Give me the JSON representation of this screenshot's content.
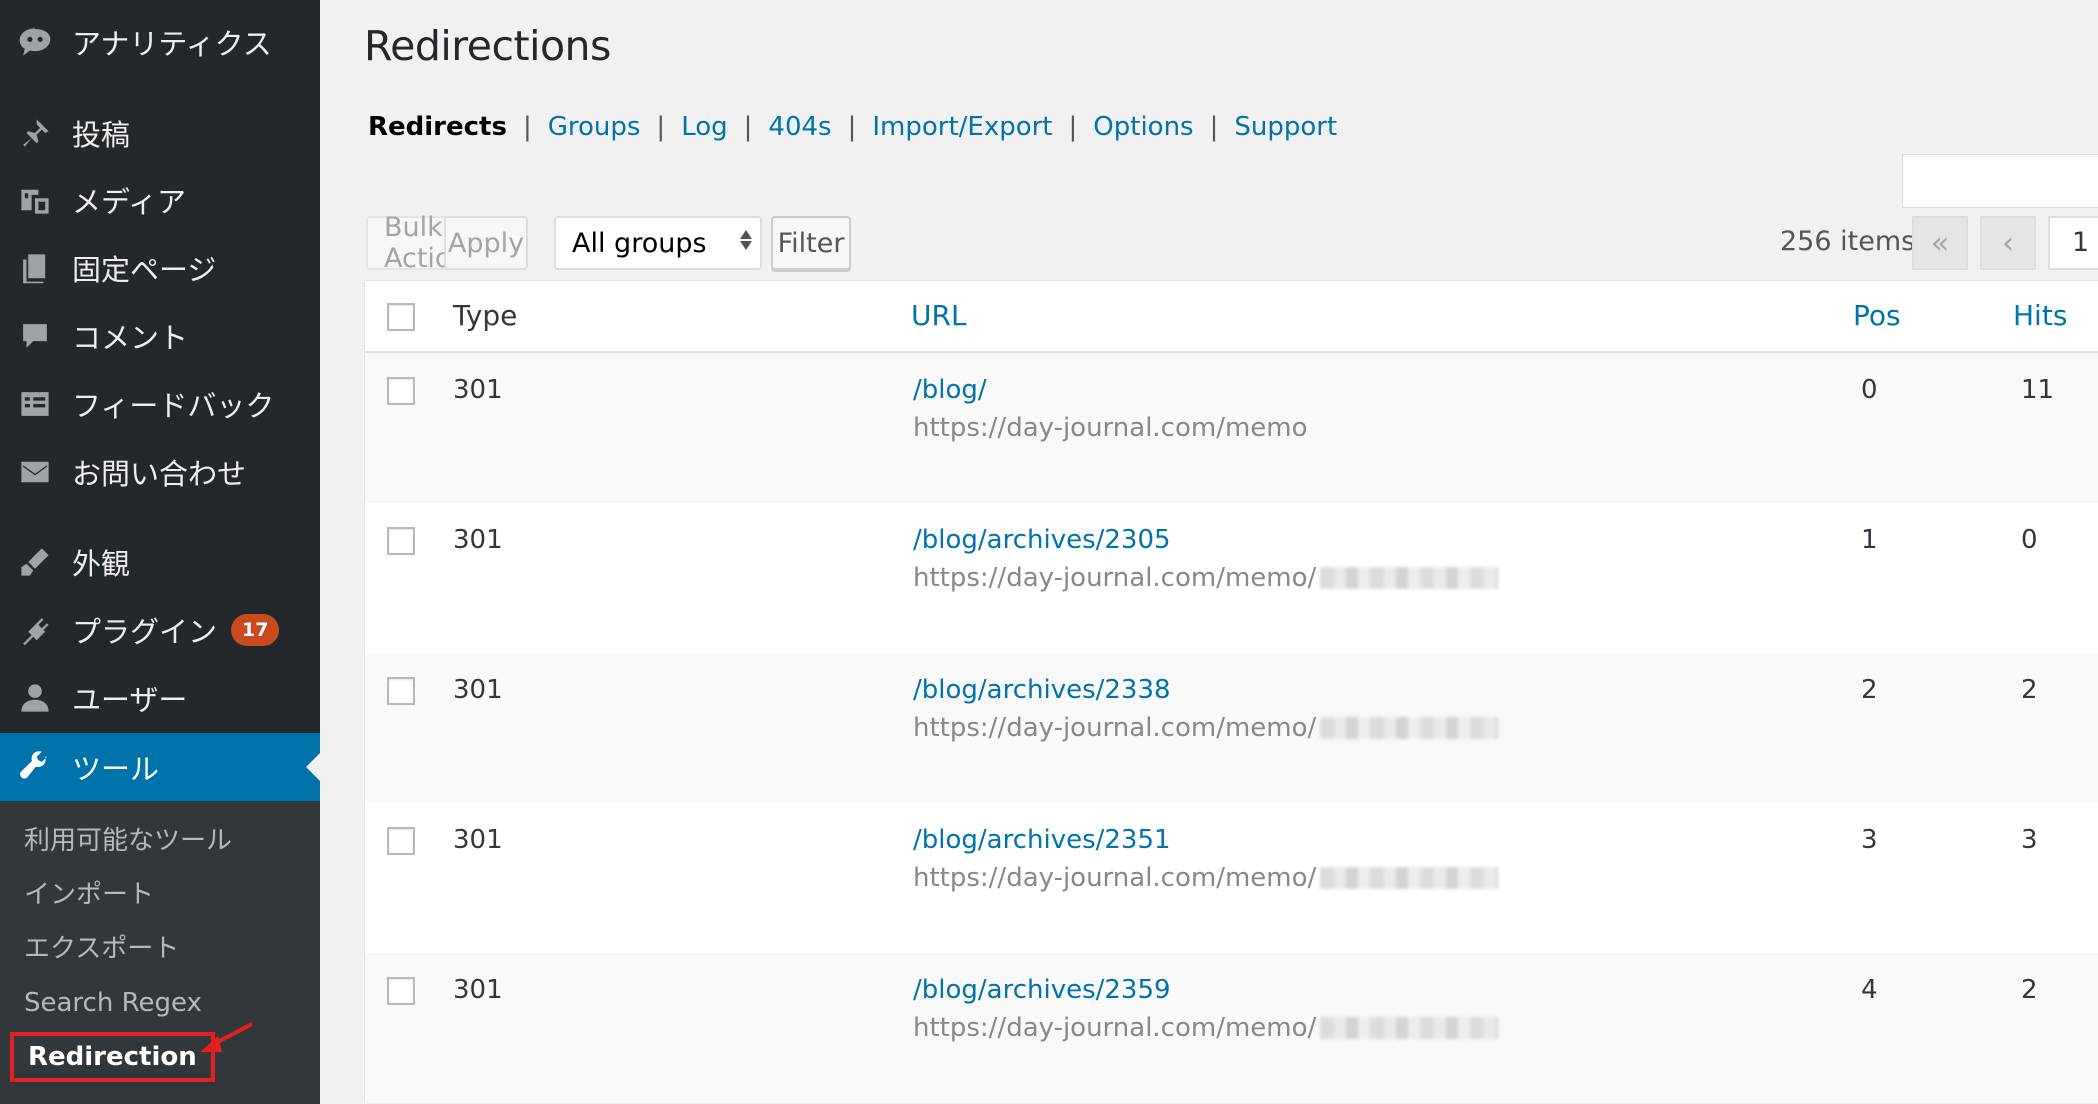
{
  "sidebar": {
    "top_item": {
      "label": "アナリティクス",
      "icon": "analytics-icon"
    },
    "items": [
      {
        "label": "投稿",
        "icon": "pin-icon"
      },
      {
        "label": "メディア",
        "icon": "media-icon"
      },
      {
        "label": "固定ページ",
        "icon": "pages-icon"
      },
      {
        "label": "コメント",
        "icon": "comment-icon"
      },
      {
        "label": "フィードバック",
        "icon": "feedback-icon"
      },
      {
        "label": "お問い合わせ",
        "icon": "mail-icon"
      },
      {
        "label": "外観",
        "icon": "brush-icon"
      },
      {
        "label": "プラグイン",
        "icon": "plugin-icon",
        "badge": "17"
      },
      {
        "label": "ユーザー",
        "icon": "user-icon"
      },
      {
        "label": "ツール",
        "icon": "wrench-icon",
        "active": true
      }
    ],
    "submenu": [
      {
        "label": "利用可能なツール"
      },
      {
        "label": "インポート"
      },
      {
        "label": "エクスポート"
      },
      {
        "label": "Search Regex"
      },
      {
        "label": "Redirection",
        "current": true
      }
    ],
    "accent_color": "#0073aa",
    "badge_color": "#ca4a1f",
    "highlight_color": "#e52020"
  },
  "page": {
    "title": "Redirections",
    "subnav": [
      {
        "label": "Redirects",
        "current": true
      },
      {
        "label": "Groups"
      },
      {
        "label": "Log"
      },
      {
        "label": "404s"
      },
      {
        "label": "Import/Export"
      },
      {
        "label": "Options"
      },
      {
        "label": "Support"
      }
    ]
  },
  "toolbar": {
    "bulk_actions": "Bulk Actions",
    "apply": "Apply",
    "group_select": "All groups",
    "filter": "Filter",
    "items_count": "256 items",
    "first_page": "«",
    "prev_page": "‹",
    "current_page": "1"
  },
  "table": {
    "columns": {
      "type": "Type",
      "url": "URL",
      "pos": "Pos",
      "hits": "Hits"
    },
    "rows": [
      {
        "type": "301",
        "source": "/blog/",
        "target": "https://day-journal.com/memo",
        "pos": "0",
        "hits": "11"
      },
      {
        "type": "301",
        "source": "/blog/archives/2305",
        "target": "https://day-journal.com/memo/",
        "pos": "1",
        "hits": "0"
      },
      {
        "type": "301",
        "source": "/blog/archives/2338",
        "target": "https://day-journal.com/memo/",
        "pos": "2",
        "hits": "2"
      },
      {
        "type": "301",
        "source": "/blog/archives/2351",
        "target": "https://day-journal.com/memo/",
        "pos": "3",
        "hits": "3"
      },
      {
        "type": "301",
        "source": "/blog/archives/2359",
        "target": "https://day-journal.com/memo/",
        "pos": "4",
        "hits": "2"
      }
    ]
  }
}
